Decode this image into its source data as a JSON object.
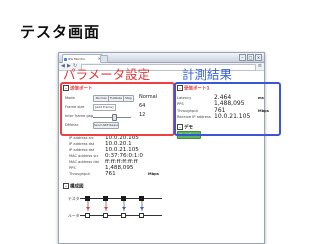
{
  "slide": {
    "title": "テスタ画面"
  },
  "browser": {
    "tab_label": "IPG Monitor",
    "tab_close": "×",
    "new_tab": "",
    "nav_back": "◀",
    "nav_forward": "▶",
    "nav_reload": "↻",
    "menu": "≡",
    "window_controls": [
      "–",
      "□",
      "×"
    ]
  },
  "overlays": {
    "left_label": "パラメータ設定",
    "right_label": "計測結果"
  },
  "sections": {
    "send_port": "送信ポート",
    "recv_port": "受信ポート1",
    "demo": "デモ",
    "topology": "構成図"
  },
  "send_form": {
    "mode_label": "Mode",
    "mode_buttons": [
      "Normal",
      "FullRate",
      "Step"
    ],
    "mode_value": "Normal",
    "frame_size_label": "Frame size",
    "frame_size_select": "[Add Frame]",
    "frame_size_value": "64",
    "inter_frame_gap_label": "Inter frame gap",
    "inter_frame_gap_value": "12",
    "inter_frame_gap_fraction": 0.55,
    "dstmac_label": "DMmac",
    "dstmac_button": "Send ARP Request"
  },
  "recv_results": {
    "latency_label": "Latency",
    "latency_value": "2.464",
    "latency_unit": "ms",
    "pps_label": "PPS",
    "pps_value": "1,488,095",
    "throughput_label": "Throughput",
    "throughput_value": "761",
    "throughput_unit": "Mbps",
    "peer_ip_label": "Receive IP address",
    "peer_ip_value": "10.0.21.105"
  },
  "demo": {
    "button": "Start Demo"
  },
  "send_info": {
    "rows": [
      {
        "label": "IP address src",
        "value": "10.0.20.105"
      },
      {
        "label": "IP address dst",
        "value": "10.0.20.1"
      },
      {
        "label": "IP address dst",
        "value": "10.0.21.105"
      },
      {
        "label": "MAC address src",
        "value": "0:37:76:0:1:0"
      },
      {
        "label": "MAC address dst",
        "value": "ff:ff:ff:ff:ff:ff"
      },
      {
        "label": "PPS",
        "value": "1,488,095"
      },
      {
        "label": "Throughput",
        "value": "761",
        "unit": "Mbps"
      }
    ]
  },
  "topology": {
    "top_label": "テスタ",
    "bottom_label": "ルータ"
  }
}
